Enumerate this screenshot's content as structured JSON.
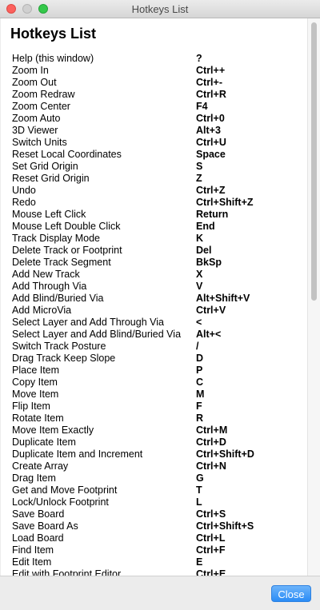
{
  "window": {
    "title": "Hotkeys List"
  },
  "heading": "Hotkeys List",
  "hotkeys": [
    {
      "action": "Help (this window)",
      "key": "?"
    },
    {
      "action": "Zoom In",
      "key": "Ctrl++"
    },
    {
      "action": "Zoom Out",
      "key": "Ctrl+-"
    },
    {
      "action": "Zoom Redraw",
      "key": "Ctrl+R"
    },
    {
      "action": "Zoom Center",
      "key": "F4"
    },
    {
      "action": "Zoom Auto",
      "key": "Ctrl+0"
    },
    {
      "action": "3D Viewer",
      "key": "Alt+3"
    },
    {
      "action": "Switch Units",
      "key": "Ctrl+U"
    },
    {
      "action": "Reset Local Coordinates",
      "key": "Space"
    },
    {
      "action": "Set Grid Origin",
      "key": "S"
    },
    {
      "action": "Reset Grid Origin",
      "key": "Z"
    },
    {
      "action": "Undo",
      "key": "Ctrl+Z"
    },
    {
      "action": "Redo",
      "key": "Ctrl+Shift+Z"
    },
    {
      "action": "Mouse Left Click",
      "key": "Return"
    },
    {
      "action": "Mouse Left Double Click",
      "key": "End"
    },
    {
      "action": "Track Display Mode",
      "key": "K"
    },
    {
      "action": "Delete Track or Footprint",
      "key": "Del"
    },
    {
      "action": "Delete Track Segment",
      "key": "BkSp"
    },
    {
      "action": "Add New Track",
      "key": "X"
    },
    {
      "action": "Add Through Via",
      "key": "V"
    },
    {
      "action": "Add Blind/Buried Via",
      "key": "Alt+Shift+V"
    },
    {
      "action": "Add MicroVia",
      "key": "Ctrl+V"
    },
    {
      "action": "Select Layer and Add Through Via",
      "key": "<"
    },
    {
      "action": "Select Layer and Add Blind/Buried Via",
      "key": "Alt+<"
    },
    {
      "action": "Switch Track Posture",
      "key": "/"
    },
    {
      "action": "Drag Track Keep Slope",
      "key": "D"
    },
    {
      "action": "Place Item",
      "key": "P"
    },
    {
      "action": "Copy Item",
      "key": "C"
    },
    {
      "action": "Move Item",
      "key": "M"
    },
    {
      "action": "Flip Item",
      "key": "F"
    },
    {
      "action": "Rotate Item",
      "key": "R"
    },
    {
      "action": "Move Item Exactly",
      "key": "Ctrl+M"
    },
    {
      "action": "Duplicate Item",
      "key": "Ctrl+D"
    },
    {
      "action": "Duplicate Item and Increment",
      "key": "Ctrl+Shift+D"
    },
    {
      "action": "Create Array",
      "key": "Ctrl+N"
    },
    {
      "action": "Drag Item",
      "key": "G"
    },
    {
      "action": "Get and Move Footprint",
      "key": "T"
    },
    {
      "action": "Lock/Unlock Footprint",
      "key": "L"
    },
    {
      "action": "Save Board",
      "key": "Ctrl+S"
    },
    {
      "action": "Save Board As",
      "key": "Ctrl+Shift+S"
    },
    {
      "action": "Load Board",
      "key": "Ctrl+L"
    },
    {
      "action": "Find Item",
      "key": "Ctrl+F"
    },
    {
      "action": "Edit Item",
      "key": "E"
    },
    {
      "action": "Edit with Footprint Editor",
      "key": "Ctrl+E"
    }
  ],
  "buttons": {
    "close_label": "Close"
  }
}
